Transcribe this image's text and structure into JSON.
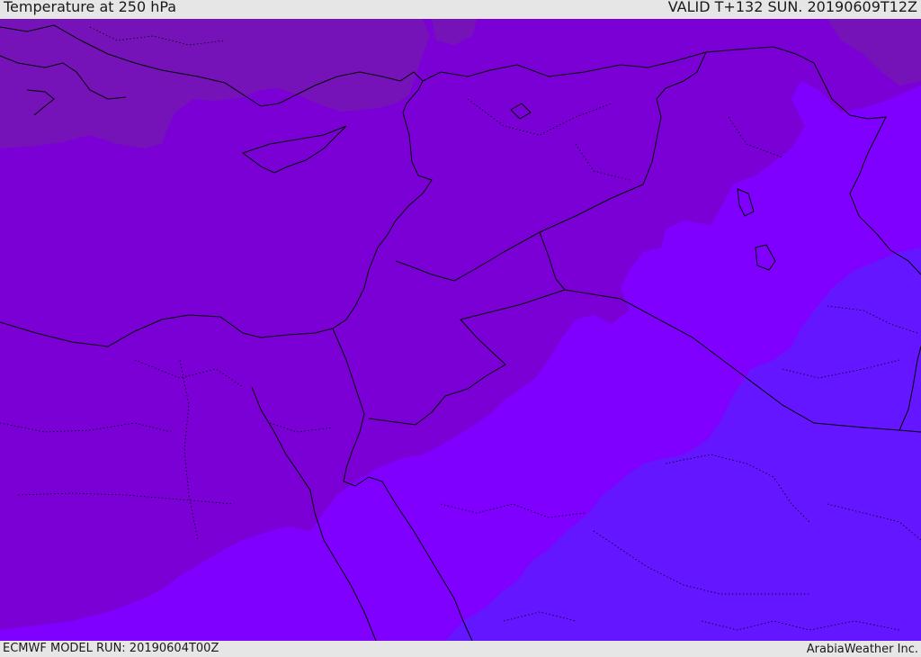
{
  "header": {
    "title": "Temperature at 250 hPa",
    "valid": "VALID T+132 SUN. 20190609T12Z"
  },
  "footer": {
    "model_run": "ECMWF MODEL RUN: 20190604T00Z",
    "credit": "ArabiaWeather Inc."
  },
  "map": {
    "colors": {
      "band_coldest": "#7613b8",
      "band_cold": "#7a00d6",
      "band_mid": "#7f00ff",
      "band_warm": "#6316ff",
      "coastline": "#000000",
      "border": "#000000"
    }
  }
}
